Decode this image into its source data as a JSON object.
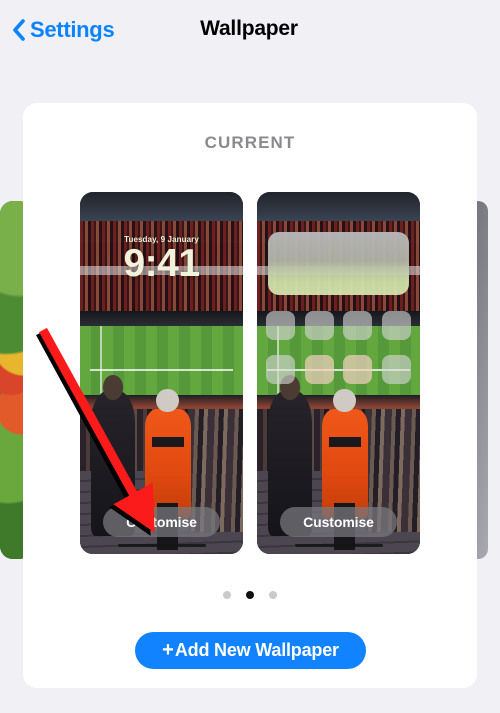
{
  "nav": {
    "back_label": "Settings",
    "back_icon": "chevron-left-icon",
    "title": "Wallpaper"
  },
  "card": {
    "section_heading": "CURRENT"
  },
  "previews": {
    "lock_screen": {
      "date": "Tuesday, 9 January",
      "time": "9:41",
      "customise_label": "Customise"
    },
    "home_screen": {
      "customise_label": "Customise",
      "app_icon_count": 8
    }
  },
  "pagination": {
    "dots": [
      {
        "active": false
      },
      {
        "active": true
      },
      {
        "active": false
      }
    ]
  },
  "add_wallpaper": {
    "plus_icon": "plus-icon",
    "label": "Add New Wallpaper"
  },
  "annotation": {
    "arrow_color": "#fc1b1b",
    "shadow_color": "#000000",
    "points_to": "Customise"
  },
  "colors": {
    "page_background": "#f1f0f5",
    "card_background": "#ffffff",
    "accent_blue": "#0a84ff",
    "button_blue": "#1283ff",
    "heading_gray": "#8a8a8e"
  }
}
